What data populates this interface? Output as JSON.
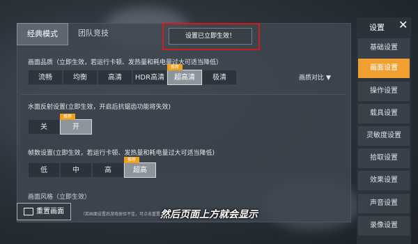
{
  "tabs": [
    {
      "label": "经典模式"
    },
    {
      "label": "团队竞技"
    }
  ],
  "toast": "设置已立即生效！",
  "graphics_quality": {
    "title": "画面品质（立即生效，若运行卡顿、发热量和耗电量过大可适当降低）",
    "options": [
      "流畅",
      "均衡",
      "高清",
      "HDR高清",
      "超高清",
      "极清"
    ],
    "selected": "超高清",
    "recommend_badge": "推荐",
    "compare_label": "画质对比"
  },
  "water_reflection": {
    "title": "水面反射设置(立即生效，开启后抗锯齿功能将失效)",
    "options": [
      "关",
      "开"
    ],
    "selected": "开",
    "recommend_badge": "推荐"
  },
  "frame_rate": {
    "title": "帧数设置(立即生效，若运行卡顿、发热量和耗电量过大可适当降低)",
    "options": [
      "低",
      "中",
      "高",
      "超高"
    ],
    "selected": "超高",
    "recommend_badge": "推荐"
  },
  "cut_section_title": "画面风格（立即生效）",
  "sidebar": {
    "title": "设置",
    "items": [
      {
        "label": "基础设置"
      },
      {
        "label": "画面设置"
      },
      {
        "label": "操作设置"
      },
      {
        "label": "载具设置"
      },
      {
        "label": "灵敏度设置"
      },
      {
        "label": "拾取设置"
      },
      {
        "label": "效果设置"
      },
      {
        "label": "声音设置"
      },
      {
        "label": "录像设置"
      }
    ],
    "active": "画面设置"
  },
  "bottom": {
    "reset_label": "重置画面",
    "note": "（若画面设置后游戏体验不佳，可点击重置…"
  },
  "caption": "然后页面上方就会显示",
  "colors": {
    "accent": "#f0a030",
    "highlight_box": "#d21c1c"
  }
}
